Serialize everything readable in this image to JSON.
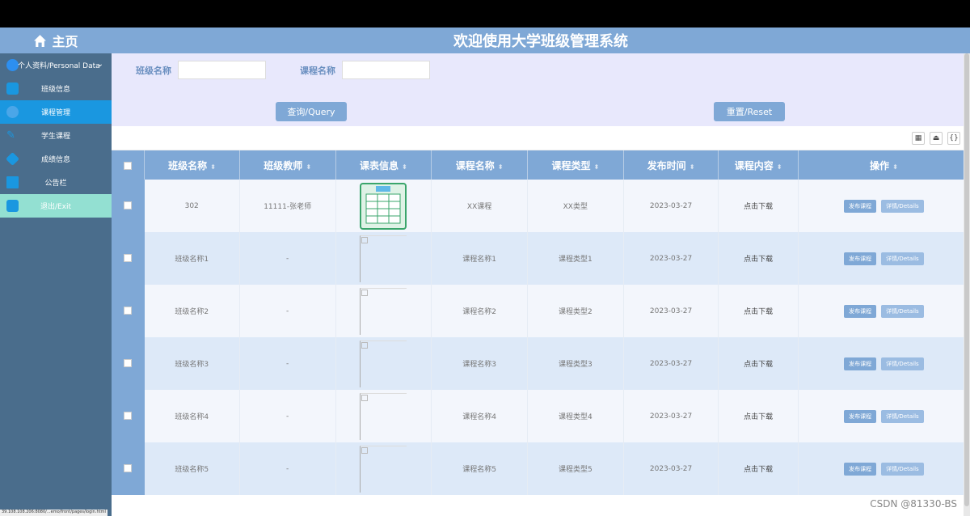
{
  "sidebar": {
    "home_label": "主页",
    "profile_label": "个人资料/Personal Data",
    "items": [
      {
        "label": "班级信息",
        "icon": "id-card-icon"
      },
      {
        "label": "课程管理",
        "icon": "globe-icon"
      },
      {
        "label": "学生课程",
        "icon": "pencil-icon"
      },
      {
        "label": "成绩信息",
        "icon": "tag-icon"
      },
      {
        "label": "公告栏",
        "icon": "building-icon"
      },
      {
        "label": "退出/Exit",
        "icon": "exit-icon"
      }
    ]
  },
  "header": {
    "title": "欢迎使用大学班级管理系统"
  },
  "search": {
    "class_label": "班级名称",
    "course_label": "课程名称",
    "query_label": "查询/Query",
    "reset_label": "重置/Reset"
  },
  "table": {
    "headers": [
      "班级名称",
      "班级教师",
      "课表信息",
      "课程名称",
      "课程类型",
      "发布时间",
      "课程内容",
      "操作"
    ],
    "rows": [
      {
        "class": "302",
        "teacher": "11111-张老师",
        "course": "XX课程",
        "type": "XX类型",
        "date": "2023-03-27",
        "content": "点击下载"
      },
      {
        "class": "班级名称1",
        "teacher": "-",
        "course": "课程名称1",
        "type": "课程类型1",
        "date": "2023-03-27",
        "content": "点击下载"
      },
      {
        "class": "班级名称2",
        "teacher": "-",
        "course": "课程名称2",
        "type": "课程类型2",
        "date": "2023-03-27",
        "content": "点击下载"
      },
      {
        "class": "班级名称3",
        "teacher": "-",
        "course": "课程名称3",
        "type": "课程类型3",
        "date": "2023-03-27",
        "content": "点击下载"
      },
      {
        "class": "班级名称4",
        "teacher": "-",
        "course": "课程名称4",
        "type": "课程类型4",
        "date": "2023-03-27",
        "content": "点击下载"
      },
      {
        "class": "班级名称5",
        "teacher": "-",
        "course": "课程名称5",
        "type": "课程类型5",
        "date": "2023-03-27",
        "content": "点击下载"
      }
    ],
    "op_publish": "发布课程",
    "op_details": "详情/Details"
  },
  "status_url": "39.108.108.206:8080/...emo/front/pages/login.html",
  "watermark": "CSDN @81330-BS"
}
